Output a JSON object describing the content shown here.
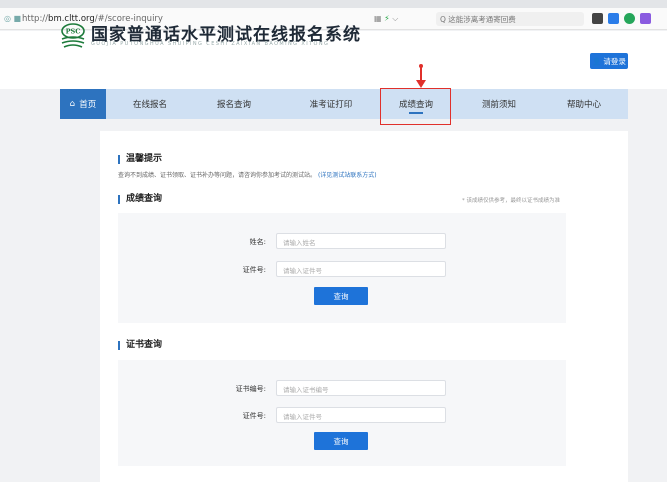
{
  "browser": {
    "url_prefix": "http://",
    "url_host": "bm.cltt.org",
    "url_path": "/#/score-inquiry",
    "search_placeholder": "Q 这能涉离考通寄回费"
  },
  "site": {
    "logo_text": "PSC",
    "title": "国家普通话水平测试在线报名系统",
    "subtitle": "GUOJIA PUTONGHUA SHUIPING CESHI ZAIXIAN BAOMING XITONG",
    "login_label": "请登录"
  },
  "nav": {
    "items": [
      {
        "label": "首页"
      },
      {
        "label": "在线报名"
      },
      {
        "label": "报名查询"
      },
      {
        "label": "准考证打印"
      },
      {
        "label": "成绩查询"
      },
      {
        "label": "测前须知"
      },
      {
        "label": "帮助中心"
      }
    ]
  },
  "tip": {
    "title": "温馨提示",
    "text": "查询不到成绩、证书领取、证书补办等问题，请咨询你参加考试的测试站。",
    "link": "(详见测试站联系方式)"
  },
  "score": {
    "title": "成绩查询",
    "note": "* 该成绩仅供参考，最终以证书成绩为准",
    "name_label": "姓名:",
    "name_placeholder": "请输入姓名",
    "id_label": "证件号:",
    "id_placeholder": "请输入证件号",
    "button": "查询"
  },
  "cert": {
    "title": "证书查询",
    "no_label": "证书编号:",
    "no_placeholder": "请输入证书编号",
    "id_label": "证件号:",
    "id_placeholder": "请输入证件号",
    "button": "查询"
  },
  "colors": {
    "accent": "#1e73d9",
    "nav_bg": "#cfe0f3",
    "highlight": "#e0302b"
  }
}
